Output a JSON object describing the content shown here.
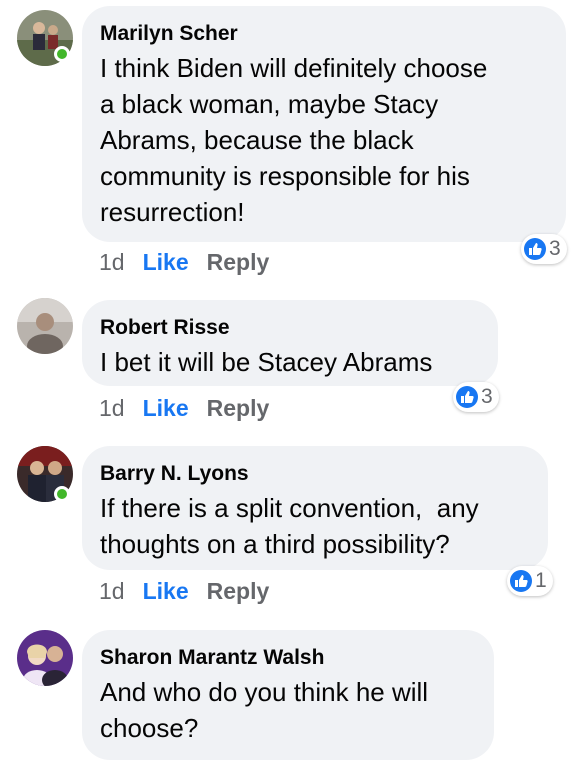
{
  "comments": [
    {
      "author": "Marilyn Scher",
      "lines": [
        "I think Biden will definitely choose",
        "a black woman, maybe Stacy",
        "Abrams, because the black",
        "community is responsible for his",
        "resurrection!"
      ],
      "time": "1d",
      "like_label": "Like",
      "reply_label": "Reply",
      "reaction_count": "3",
      "online": true
    },
    {
      "author": "Robert Risse",
      "lines": [
        "I bet it will be Stacey Abrams"
      ],
      "time": "1d",
      "like_label": "Like",
      "reply_label": "Reply",
      "reaction_count": "3",
      "online": false
    },
    {
      "author": "Barry N. Lyons",
      "lines": [
        "If there is a split convention,  any",
        "thoughts on a third possibility?"
      ],
      "time": "1d",
      "like_label": "Like",
      "reply_label": "Reply",
      "reaction_count": "1",
      "online": true
    },
    {
      "author": "Sharon Marantz Walsh",
      "lines": [
        "And who do you think he will",
        "choose?"
      ],
      "online": false
    }
  ],
  "colors": {
    "like_blue": "#1877f2",
    "bubble_bg": "#f0f2f5",
    "online_green": "#42b72a"
  }
}
